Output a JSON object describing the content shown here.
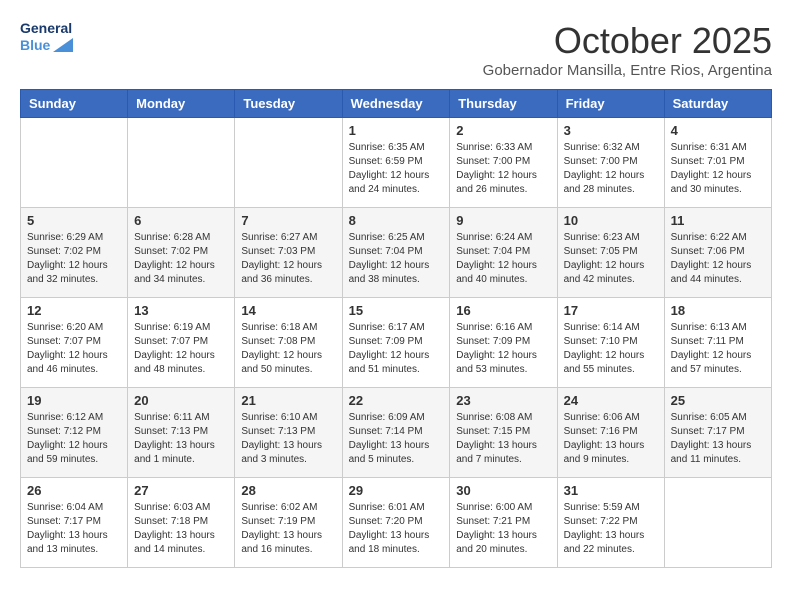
{
  "header": {
    "logo_line1": "General",
    "logo_line2": "Blue",
    "month": "October 2025",
    "location": "Gobernador Mansilla, Entre Rios, Argentina"
  },
  "days_of_week": [
    "Sunday",
    "Monday",
    "Tuesday",
    "Wednesday",
    "Thursday",
    "Friday",
    "Saturday"
  ],
  "weeks": [
    [
      {
        "day": "",
        "info": ""
      },
      {
        "day": "",
        "info": ""
      },
      {
        "day": "",
        "info": ""
      },
      {
        "day": "1",
        "info": "Sunrise: 6:35 AM\nSunset: 6:59 PM\nDaylight: 12 hours\nand 24 minutes."
      },
      {
        "day": "2",
        "info": "Sunrise: 6:33 AM\nSunset: 7:00 PM\nDaylight: 12 hours\nand 26 minutes."
      },
      {
        "day": "3",
        "info": "Sunrise: 6:32 AM\nSunset: 7:00 PM\nDaylight: 12 hours\nand 28 minutes."
      },
      {
        "day": "4",
        "info": "Sunrise: 6:31 AM\nSunset: 7:01 PM\nDaylight: 12 hours\nand 30 minutes."
      }
    ],
    [
      {
        "day": "5",
        "info": "Sunrise: 6:29 AM\nSunset: 7:02 PM\nDaylight: 12 hours\nand 32 minutes."
      },
      {
        "day": "6",
        "info": "Sunrise: 6:28 AM\nSunset: 7:02 PM\nDaylight: 12 hours\nand 34 minutes."
      },
      {
        "day": "7",
        "info": "Sunrise: 6:27 AM\nSunset: 7:03 PM\nDaylight: 12 hours\nand 36 minutes."
      },
      {
        "day": "8",
        "info": "Sunrise: 6:25 AM\nSunset: 7:04 PM\nDaylight: 12 hours\nand 38 minutes."
      },
      {
        "day": "9",
        "info": "Sunrise: 6:24 AM\nSunset: 7:04 PM\nDaylight: 12 hours\nand 40 minutes."
      },
      {
        "day": "10",
        "info": "Sunrise: 6:23 AM\nSunset: 7:05 PM\nDaylight: 12 hours\nand 42 minutes."
      },
      {
        "day": "11",
        "info": "Sunrise: 6:22 AM\nSunset: 7:06 PM\nDaylight: 12 hours\nand 44 minutes."
      }
    ],
    [
      {
        "day": "12",
        "info": "Sunrise: 6:20 AM\nSunset: 7:07 PM\nDaylight: 12 hours\nand 46 minutes."
      },
      {
        "day": "13",
        "info": "Sunrise: 6:19 AM\nSunset: 7:07 PM\nDaylight: 12 hours\nand 48 minutes."
      },
      {
        "day": "14",
        "info": "Sunrise: 6:18 AM\nSunset: 7:08 PM\nDaylight: 12 hours\nand 50 minutes."
      },
      {
        "day": "15",
        "info": "Sunrise: 6:17 AM\nSunset: 7:09 PM\nDaylight: 12 hours\nand 51 minutes."
      },
      {
        "day": "16",
        "info": "Sunrise: 6:16 AM\nSunset: 7:09 PM\nDaylight: 12 hours\nand 53 minutes."
      },
      {
        "day": "17",
        "info": "Sunrise: 6:14 AM\nSunset: 7:10 PM\nDaylight: 12 hours\nand 55 minutes."
      },
      {
        "day": "18",
        "info": "Sunrise: 6:13 AM\nSunset: 7:11 PM\nDaylight: 12 hours\nand 57 minutes."
      }
    ],
    [
      {
        "day": "19",
        "info": "Sunrise: 6:12 AM\nSunset: 7:12 PM\nDaylight: 12 hours\nand 59 minutes."
      },
      {
        "day": "20",
        "info": "Sunrise: 6:11 AM\nSunset: 7:13 PM\nDaylight: 13 hours\nand 1 minute."
      },
      {
        "day": "21",
        "info": "Sunrise: 6:10 AM\nSunset: 7:13 PM\nDaylight: 13 hours\nand 3 minutes."
      },
      {
        "day": "22",
        "info": "Sunrise: 6:09 AM\nSunset: 7:14 PM\nDaylight: 13 hours\nand 5 minutes."
      },
      {
        "day": "23",
        "info": "Sunrise: 6:08 AM\nSunset: 7:15 PM\nDaylight: 13 hours\nand 7 minutes."
      },
      {
        "day": "24",
        "info": "Sunrise: 6:06 AM\nSunset: 7:16 PM\nDaylight: 13 hours\nand 9 minutes."
      },
      {
        "day": "25",
        "info": "Sunrise: 6:05 AM\nSunset: 7:17 PM\nDaylight: 13 hours\nand 11 minutes."
      }
    ],
    [
      {
        "day": "26",
        "info": "Sunrise: 6:04 AM\nSunset: 7:17 PM\nDaylight: 13 hours\nand 13 minutes."
      },
      {
        "day": "27",
        "info": "Sunrise: 6:03 AM\nSunset: 7:18 PM\nDaylight: 13 hours\nand 14 minutes."
      },
      {
        "day": "28",
        "info": "Sunrise: 6:02 AM\nSunset: 7:19 PM\nDaylight: 13 hours\nand 16 minutes."
      },
      {
        "day": "29",
        "info": "Sunrise: 6:01 AM\nSunset: 7:20 PM\nDaylight: 13 hours\nand 18 minutes."
      },
      {
        "day": "30",
        "info": "Sunrise: 6:00 AM\nSunset: 7:21 PM\nDaylight: 13 hours\nand 20 minutes."
      },
      {
        "day": "31",
        "info": "Sunrise: 5:59 AM\nSunset: 7:22 PM\nDaylight: 13 hours\nand 22 minutes."
      },
      {
        "day": "",
        "info": ""
      }
    ]
  ]
}
